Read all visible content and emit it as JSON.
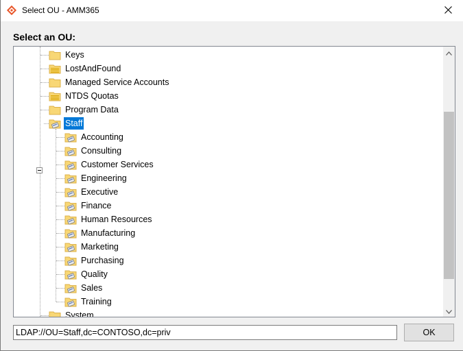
{
  "window": {
    "title": "Select OU - AMM365",
    "close_glyph": "✕"
  },
  "heading": "Select an OU:",
  "tree": {
    "top_items": [
      {
        "label": "Keys",
        "icon": "folder-icon"
      },
      {
        "label": "LostAndFound",
        "icon": "container-folder-icon"
      },
      {
        "label": "Managed Service Accounts",
        "icon": "folder-icon"
      },
      {
        "label": "NTDS Quotas",
        "icon": "container-folder-icon"
      },
      {
        "label": "Program Data",
        "icon": "folder-icon"
      }
    ],
    "selected": {
      "label": "Staff",
      "icon": "ou-folder-icon",
      "expanded": true
    },
    "children": [
      "Accounting",
      "Consulting",
      "Customer Services",
      "Engineering",
      "Executive",
      "Finance",
      "Human Resources",
      "Manufacturing",
      "Marketing",
      "Purchasing",
      "Quality",
      "Sales",
      "Training"
    ],
    "cut_off_item": "System"
  },
  "path_field": {
    "value": "LDAP://OU=Staff,dc=CONTOSO,dc=priv"
  },
  "ok_button": {
    "label": "OK"
  },
  "colors": {
    "selection": "#0078d7",
    "folder": "#f8d775",
    "folder_edge": "#dcb14a",
    "accent_icon": "#e8562a"
  }
}
